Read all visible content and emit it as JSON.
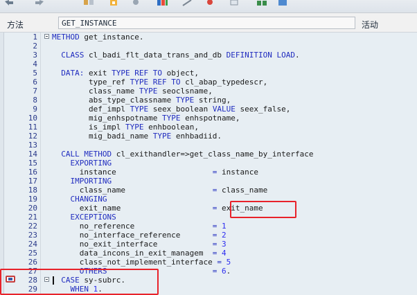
{
  "toolbar": {
    "icons": [
      "back-arrow-icon",
      "forward-arrow-icon",
      "display-change-icon",
      "syntax-check-icon",
      "activate-icon",
      "where-used-icon",
      "object-list-icon",
      "pattern-icon",
      "enhance-icon",
      "tree-icon",
      "test-icon"
    ]
  },
  "header": {
    "method_label": "方法",
    "method_value": "GET_INSTANCE",
    "status_label": "活动"
  },
  "editor": {
    "lines": [
      {
        "num": "1",
        "fold": true,
        "tokens": [
          {
            "t": "METHOD",
            "c": "kw"
          },
          {
            "t": " get_instance.",
            "c": "cm"
          }
        ]
      },
      {
        "num": "2",
        "fold": false,
        "tokens": []
      },
      {
        "num": "3",
        "fold": false,
        "tokens": [
          {
            "t": "  CLASS",
            "c": "kw"
          },
          {
            "t": " cl_badi_flt_data_trans_and_db ",
            "c": "cm"
          },
          {
            "t": "DEFINITION LOAD",
            "c": "kw"
          },
          {
            "t": ".",
            "c": "cm"
          }
        ]
      },
      {
        "num": "4",
        "fold": false,
        "tokens": []
      },
      {
        "num": "5",
        "fold": false,
        "tokens": [
          {
            "t": "  DATA:",
            "c": "kw"
          },
          {
            "t": " exit ",
            "c": "cm"
          },
          {
            "t": "TYPE REF TO",
            "c": "kw"
          },
          {
            "t": " object,",
            "c": "cm"
          }
        ]
      },
      {
        "num": "6",
        "fold": false,
        "tokens": [
          {
            "t": "        type_ref ",
            "c": "cm"
          },
          {
            "t": "TYPE REF TO",
            "c": "kw"
          },
          {
            "t": " cl_abap_typedescr,",
            "c": "cm"
          }
        ]
      },
      {
        "num": "7",
        "fold": false,
        "tokens": [
          {
            "t": "        class_name ",
            "c": "cm"
          },
          {
            "t": "TYPE",
            "c": "kw"
          },
          {
            "t": " seoclsname,",
            "c": "cm"
          }
        ]
      },
      {
        "num": "8",
        "fold": false,
        "tokens": [
          {
            "t": "        abs_type_classname ",
            "c": "cm"
          },
          {
            "t": "TYPE",
            "c": "kw"
          },
          {
            "t": " string,",
            "c": "cm"
          }
        ]
      },
      {
        "num": "9",
        "fold": false,
        "tokens": [
          {
            "t": "        def_impl ",
            "c": "cm"
          },
          {
            "t": "TYPE",
            "c": "kw"
          },
          {
            "t": " seex_boolean ",
            "c": "cm"
          },
          {
            "t": "VALUE",
            "c": "kw"
          },
          {
            "t": " seex_false,",
            "c": "cm"
          }
        ]
      },
      {
        "num": "10",
        "fold": false,
        "tokens": [
          {
            "t": "        mig_enhspotname ",
            "c": "cm"
          },
          {
            "t": "TYPE",
            "c": "kw"
          },
          {
            "t": " enhspotname,",
            "c": "cm"
          }
        ]
      },
      {
        "num": "11",
        "fold": false,
        "tokens": [
          {
            "t": "        is_impl ",
            "c": "cm"
          },
          {
            "t": "TYPE",
            "c": "kw"
          },
          {
            "t": " enhboolean,",
            "c": "cm"
          }
        ]
      },
      {
        "num": "12",
        "fold": false,
        "tokens": [
          {
            "t": "        mig_badi_name ",
            "c": "cm"
          },
          {
            "t": "TYPE",
            "c": "kw"
          },
          {
            "t": " enhbadiid.",
            "c": "cm"
          }
        ]
      },
      {
        "num": "13",
        "fold": false,
        "tokens": []
      },
      {
        "num": "14",
        "fold": false,
        "tokens": [
          {
            "t": "  CALL METHOD",
            "c": "kw"
          },
          {
            "t": " cl_exithandler=>get_class_name_by_interface",
            "c": "cm"
          }
        ]
      },
      {
        "num": "15",
        "fold": false,
        "tokens": [
          {
            "t": "    EXPORTING",
            "c": "kw"
          }
        ]
      },
      {
        "num": "16",
        "fold": false,
        "tokens": [
          {
            "t": "      instance                     ",
            "c": "cm"
          },
          {
            "t": "=",
            "c": "kw"
          },
          {
            "t": " instance",
            "c": "cm"
          }
        ]
      },
      {
        "num": "17",
        "fold": false,
        "tokens": [
          {
            "t": "    IMPORTING",
            "c": "kw"
          }
        ]
      },
      {
        "num": "18",
        "fold": false,
        "tokens": [
          {
            "t": "      class_name                   ",
            "c": "cm"
          },
          {
            "t": "=",
            "c": "kw"
          },
          {
            "t": " class_name",
            "c": "cm"
          }
        ]
      },
      {
        "num": "19",
        "fold": false,
        "tokens": [
          {
            "t": "    CHANGING",
            "c": "kw"
          }
        ]
      },
      {
        "num": "20",
        "fold": false,
        "tokens": [
          {
            "t": "      exit_name                    ",
            "c": "cm"
          },
          {
            "t": "=",
            "c": "kw"
          },
          {
            "t": " exit_name",
            "c": "cm"
          }
        ]
      },
      {
        "num": "21",
        "fold": false,
        "tokens": [
          {
            "t": "    EXCEPTIONS",
            "c": "kw"
          }
        ]
      },
      {
        "num": "22",
        "fold": false,
        "tokens": [
          {
            "t": "      no_reference                 ",
            "c": "cm"
          },
          {
            "t": "=",
            "c": "kw"
          },
          {
            "t": " 1",
            "c": "nm"
          }
        ]
      },
      {
        "num": "23",
        "fold": false,
        "tokens": [
          {
            "t": "      no_interface_reference       ",
            "c": "cm"
          },
          {
            "t": "=",
            "c": "kw"
          },
          {
            "t": " 2",
            "c": "nm"
          }
        ]
      },
      {
        "num": "24",
        "fold": false,
        "tokens": [
          {
            "t": "      no_exit_interface            ",
            "c": "cm"
          },
          {
            "t": "=",
            "c": "kw"
          },
          {
            "t": " 3",
            "c": "nm"
          }
        ]
      },
      {
        "num": "25",
        "fold": false,
        "tokens": [
          {
            "t": "      data_incons_in_exit_managem  ",
            "c": "cm"
          },
          {
            "t": "=",
            "c": "kw"
          },
          {
            "t": " 4",
            "c": "nm"
          }
        ]
      },
      {
        "num": "26",
        "fold": false,
        "tokens": [
          {
            "t": "      class_not_implement_interface ",
            "c": "cm"
          },
          {
            "t": "=",
            "c": "kw"
          },
          {
            "t": " 5",
            "c": "nm"
          }
        ]
      },
      {
        "num": "27",
        "fold": false,
        "tokens": [
          {
            "t": "      OTHERS                       ",
            "c": "kw"
          },
          {
            "t": "=",
            "c": "kw"
          },
          {
            "t": " 6",
            "c": "nm"
          },
          {
            "t": ".",
            "c": "cm"
          }
        ]
      },
      {
        "num": "28",
        "fold": true,
        "tokens": [
          {
            "t": "  CASE",
            "c": "kw"
          },
          {
            "t": " sy-subrc.",
            "c": "cm"
          }
        ]
      },
      {
        "num": "29",
        "fold": false,
        "tokens": [
          {
            "t": "    WHEN",
            "c": "kw"
          },
          {
            "t": " 1",
            "c": "nm"
          },
          {
            "t": ".",
            "c": "cm"
          }
        ]
      }
    ]
  },
  "colors": {
    "keyword": "#1f2bbf",
    "number": "#2d2df0",
    "highlight": "#e8222a",
    "editor_bg": "#e7eef3"
  }
}
